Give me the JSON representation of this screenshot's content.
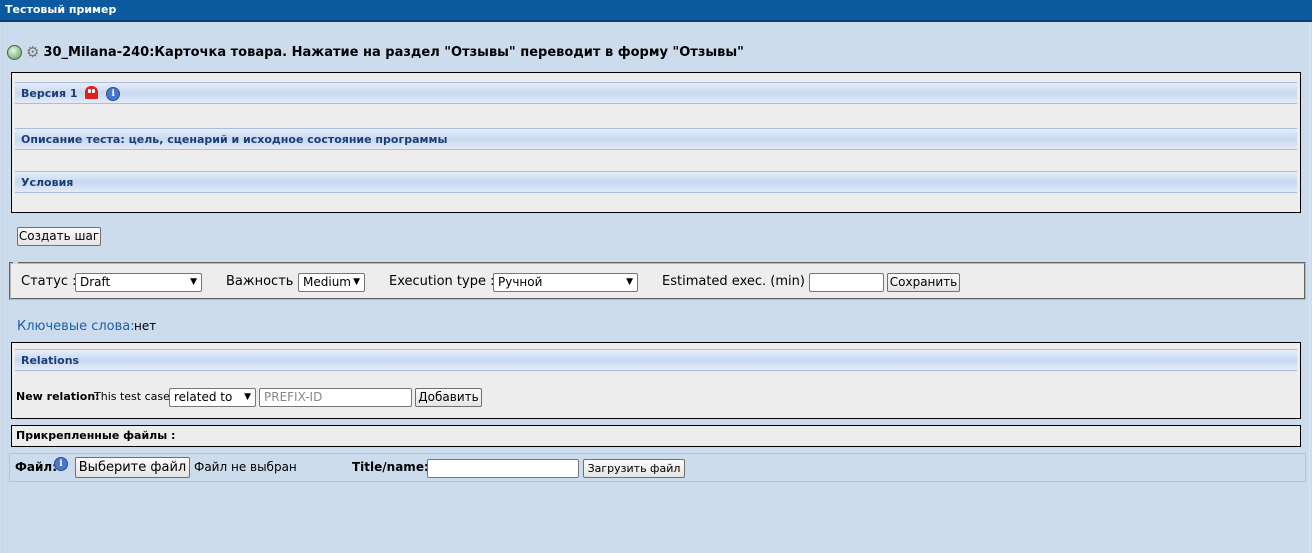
{
  "window": {
    "title": "Тестовый пример"
  },
  "testcase": {
    "title": "30_Milana-240:Карточка товара. Нажатие на раздел \"Отзывы\" переводит в форму \"Отзывы\"",
    "icons": [
      "execute-icon",
      "gear-icon"
    ]
  },
  "sections": {
    "version_label": "Версия 1",
    "description_label": "Описание теста: цель, сценарий и исходное состояние программы",
    "conditions_label": "Условия"
  },
  "create_step_button": "Создать шаг",
  "properties": {
    "status_label": "Статус :",
    "status_value": "Draft",
    "importance_label": "Важность :",
    "importance_value": "Medium",
    "exec_type_label": "Execution type :",
    "exec_type_value": "Ручной",
    "estimated_label": "Estimated exec. (min) :",
    "estimated_value": "",
    "save_button": "Сохранить"
  },
  "keywords": {
    "label": "Ключевые слова:",
    "value": "нет"
  },
  "relations": {
    "title": "Relations",
    "new_relation_label": "New relation:",
    "this_test_case": "This test case",
    "relation_type": "related to",
    "id_placeholder": "PREFIX-ID",
    "add_button": "Добавить"
  },
  "attachments": {
    "title": "Прикрепленные файлы :",
    "file_label": "Файл:",
    "choose_file_button": "Выберите файл",
    "no_file_text": "Файл не выбран",
    "title_name_label": "Title/name:",
    "title_name_value": "",
    "upload_button": "Загрузить файл"
  },
  "colors": {
    "titlebar": "#0b5aa0",
    "page_bg": "#ccdcec",
    "section_text": "#1c3e78",
    "keywords_text": "#1f5fa8"
  }
}
